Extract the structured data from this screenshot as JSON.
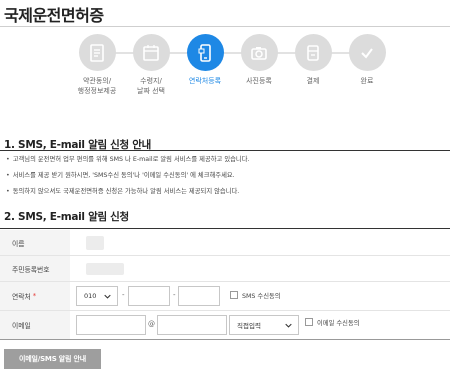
{
  "page": {
    "title": "국제운전면허증"
  },
  "stepper": {
    "steps": [
      {
        "label_line1": "약관동의/",
        "label_line2": "행정정보제공",
        "icon": "document-icon",
        "state": "done"
      },
      {
        "label_line1": "수령지/",
        "label_line2": "날짜 선택",
        "icon": "calendar-icon",
        "state": "done"
      },
      {
        "label_line1": "연락처등록",
        "label_line2": "",
        "icon": "phone-icon",
        "state": "active"
      },
      {
        "label_line1": "사진등록",
        "label_line2": "",
        "icon": "camera-icon",
        "state": "pending"
      },
      {
        "label_line1": "결제",
        "label_line2": "",
        "icon": "payment-icon",
        "state": "pending"
      },
      {
        "label_line1": "완료",
        "label_line2": "",
        "icon": "check-icon",
        "state": "pending"
      }
    ]
  },
  "section1": {
    "title": "1. SMS, E-mail 알림 신청 안내",
    "bullets": [
      "고객님의 운전면허 업무 편의를 위해 SMS 나 E-mail로 알림 서비스를 제공하고 있습니다.",
      "서비스를 제공 받기 원하시면, 'SMS수신 동의'나 '이메일 수신동의' 에 체크해주세요.",
      "동의하지 않으셔도 국제운전면허증 신청은 가능하나 알림 서비스는 제공되지 않습니다."
    ]
  },
  "section2": {
    "title": "2. SMS, E-mail 알림 신청"
  },
  "form": {
    "name_label": "이름",
    "rrn_label": "주민등록번호",
    "phone_label": "연락처",
    "phone_required_mark": "*",
    "phone_prefix": "010",
    "phone_sep1": "-",
    "phone_sep2": "-",
    "sms_consent_label": "SMS 수신동의",
    "email_label": "이메일",
    "email_at": "@",
    "email_domain_select": "직접입력",
    "email_consent_label": "이메일 수신동의"
  },
  "button": {
    "label": "이메일/SMS 알림 안내"
  }
}
